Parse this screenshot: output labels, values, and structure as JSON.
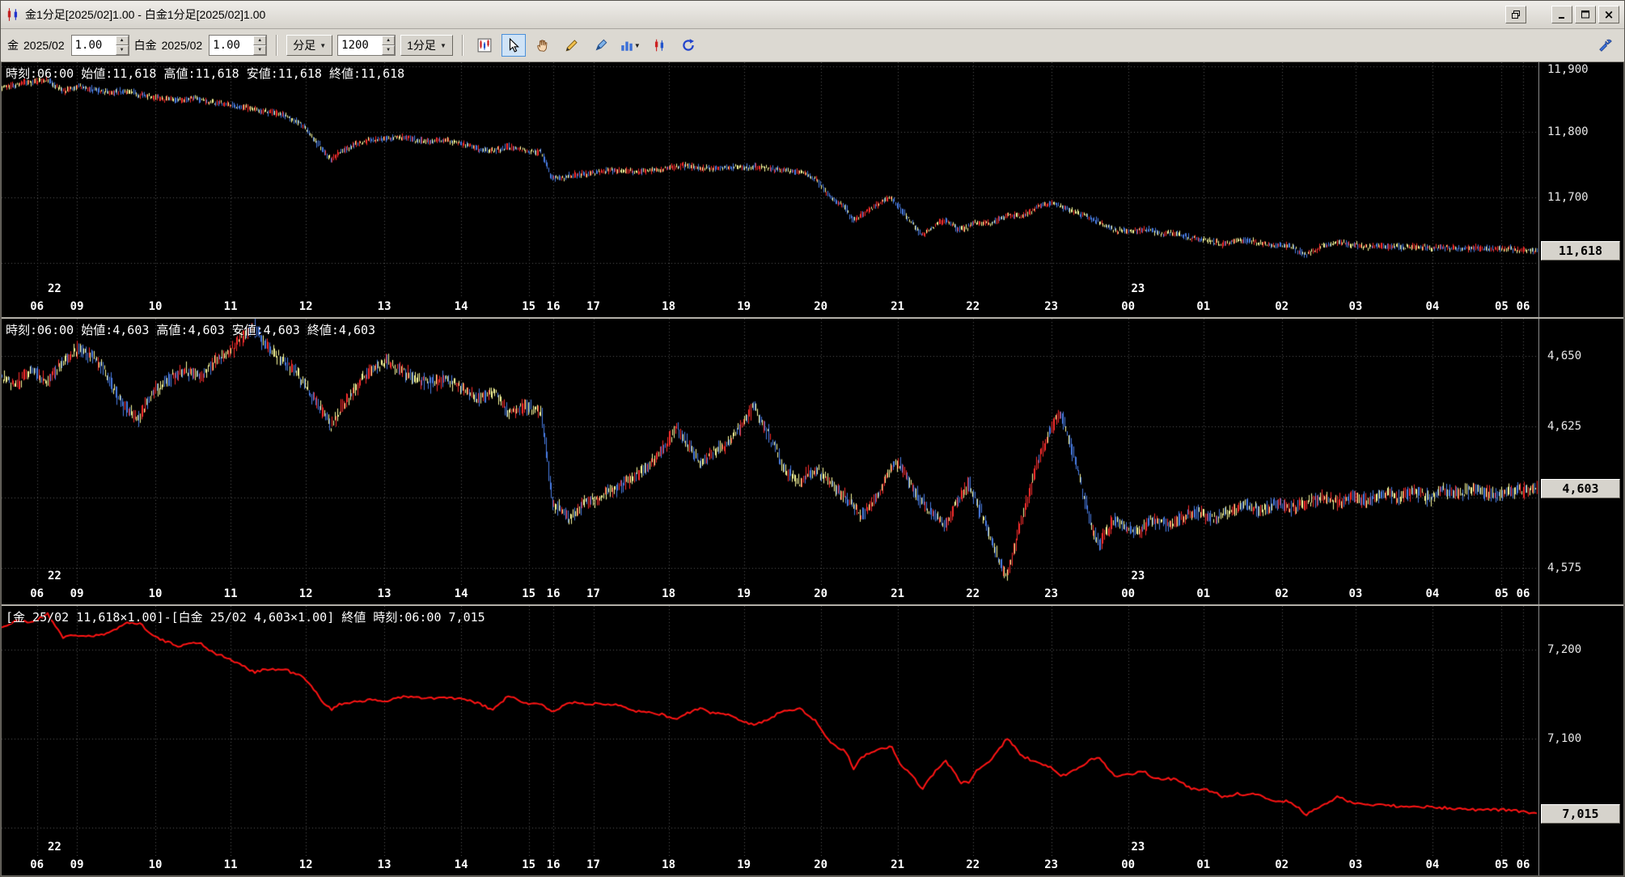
{
  "window": {
    "title": "金1分足[2025/02]1.00 - 白金1分足[2025/02]1.00",
    "close_glyph": "×"
  },
  "toolbar": {
    "gold_label": "金",
    "gold_contract": "2025/02",
    "gold_multiplier": "1.00",
    "platinum_label": "白金",
    "platinum_contract": "2025/02",
    "platinum_multiplier": "1.00",
    "period_type_label": "分足",
    "bar_count": "1200",
    "timeframe_label": "1分足",
    "icons": [
      "k-chart-icon",
      "cursor-icon",
      "hand-icon",
      "pencil-icon",
      "pen-icon",
      "histogram-icon",
      "candles-icon",
      "refresh-icon",
      "wrench-icon"
    ]
  },
  "colors": {
    "up": "#ff2e2e",
    "down": "#4b7fe8",
    "doji": "#ffff9e",
    "grid": "#565656",
    "plot_bg": "#000000",
    "axis_text": "#e8e8e8",
    "badge_bg": "#d6d3cc"
  },
  "time_axis": {
    "labels": [
      {
        "x": 0.023,
        "t": "06"
      },
      {
        "x": 0.049,
        "t": "09"
      },
      {
        "x": 0.1,
        "t": "10"
      },
      {
        "x": 0.149,
        "t": "11"
      },
      {
        "x": 0.198,
        "t": "12"
      },
      {
        "x": 0.249,
        "t": "13"
      },
      {
        "x": 0.299,
        "t": "14"
      },
      {
        "x": 0.343,
        "t": "15"
      },
      {
        "x": 0.359,
        "t": "16"
      },
      {
        "x": 0.385,
        "t": "17"
      },
      {
        "x": 0.434,
        "t": "18"
      },
      {
        "x": 0.483,
        "t": "19"
      },
      {
        "x": 0.533,
        "t": "20"
      },
      {
        "x": 0.583,
        "t": "21"
      },
      {
        "x": 0.632,
        "t": "22"
      },
      {
        "x": 0.683,
        "t": "23"
      },
      {
        "x": 0.733,
        "t": "00"
      },
      {
        "x": 0.782,
        "t": "01"
      },
      {
        "x": 0.833,
        "t": "02"
      },
      {
        "x": 0.881,
        "t": "03"
      },
      {
        "x": 0.931,
        "t": "04"
      },
      {
        "x": 0.976,
        "t": "05"
      },
      {
        "x": 0.99,
        "t": "06"
      }
    ]
  },
  "charts": [
    {
      "name": "gold",
      "type": "candlestick",
      "info_text": "時刻:06:00 始値:11,618 高値:11,618 安値:11,618 終値:11,618",
      "ylim": [
        11547,
        11906
      ],
      "yticks": [
        {
          "value": 11900,
          "label": "11,900"
        },
        {
          "value": 11800,
          "label": "11,800"
        },
        {
          "value": 11700,
          "label": "11,700"
        },
        {
          "value": 11600,
          "label": null
        }
      ],
      "badge_value": 11618,
      "badge_label": "11,618",
      "day_markers": [
        {
          "x": 0.03,
          "label": "22"
        },
        {
          "x": 0.735,
          "label": "23"
        }
      ],
      "bars": 1200,
      "noise": 6,
      "seed": 7,
      "anchors": [
        [
          0,
          11868
        ],
        [
          0.01,
          11872
        ],
        [
          0.02,
          11876
        ],
        [
          0.03,
          11880
        ],
        [
          0.04,
          11862
        ],
        [
          0.05,
          11868
        ],
        [
          0.06,
          11865
        ],
        [
          0.07,
          11860
        ],
        [
          0.08,
          11862
        ],
        [
          0.095,
          11855
        ],
        [
          0.105,
          11850
        ],
        [
          0.115,
          11848
        ],
        [
          0.125,
          11852
        ],
        [
          0.135,
          11845
        ],
        [
          0.15,
          11840
        ],
        [
          0.165,
          11835
        ],
        [
          0.175,
          11830
        ],
        [
          0.185,
          11825
        ],
        [
          0.195,
          11812
        ],
        [
          0.2,
          11800
        ],
        [
          0.205,
          11785
        ],
        [
          0.21,
          11770
        ],
        [
          0.215,
          11758
        ],
        [
          0.22,
          11768
        ],
        [
          0.23,
          11780
        ],
        [
          0.24,
          11788
        ],
        [
          0.25,
          11790
        ],
        [
          0.26,
          11792
        ],
        [
          0.27,
          11788
        ],
        [
          0.28,
          11785
        ],
        [
          0.29,
          11788
        ],
        [
          0.3,
          11782
        ],
        [
          0.31,
          11775
        ],
        [
          0.32,
          11770
        ],
        [
          0.33,
          11778
        ],
        [
          0.34,
          11772
        ],
        [
          0.352,
          11768
        ],
        [
          0.359,
          11728
        ],
        [
          0.37,
          11733
        ],
        [
          0.385,
          11738
        ],
        [
          0.4,
          11742
        ],
        [
          0.415,
          11738
        ],
        [
          0.43,
          11743
        ],
        [
          0.445,
          11748
        ],
        [
          0.46,
          11744
        ],
        [
          0.475,
          11746
        ],
        [
          0.49,
          11747
        ],
        [
          0.505,
          11743
        ],
        [
          0.52,
          11739
        ],
        [
          0.53,
          11730
        ],
        [
          0.54,
          11700
        ],
        [
          0.55,
          11685
        ],
        [
          0.555,
          11663
        ],
        [
          0.565,
          11680
        ],
        [
          0.575,
          11695
        ],
        [
          0.58,
          11700
        ],
        [
          0.59,
          11670
        ],
        [
          0.6,
          11642
        ],
        [
          0.61,
          11660
        ],
        [
          0.615,
          11665
        ],
        [
          0.625,
          11650
        ],
        [
          0.635,
          11662
        ],
        [
          0.645,
          11662
        ],
        [
          0.655,
          11672
        ],
        [
          0.665,
          11672
        ],
        [
          0.675,
          11685
        ],
        [
          0.685,
          11692
        ],
        [
          0.695,
          11682
        ],
        [
          0.705,
          11672
        ],
        [
          0.715,
          11662
        ],
        [
          0.725,
          11650
        ],
        [
          0.735,
          11648
        ],
        [
          0.745,
          11652
        ],
        [
          0.755,
          11645
        ],
        [
          0.765,
          11645
        ],
        [
          0.775,
          11638
        ],
        [
          0.785,
          11636
        ],
        [
          0.795,
          11628
        ],
        [
          0.805,
          11634
        ],
        [
          0.815,
          11633
        ],
        [
          0.825,
          11629
        ],
        [
          0.84,
          11625
        ],
        [
          0.85,
          11612
        ],
        [
          0.86,
          11625
        ],
        [
          0.87,
          11632
        ],
        [
          0.88,
          11628
        ],
        [
          0.89,
          11625
        ],
        [
          0.9,
          11626
        ],
        [
          0.91,
          11624
        ],
        [
          0.92,
          11625
        ],
        [
          0.93,
          11623
        ],
        [
          0.94,
          11624
        ],
        [
          0.95,
          11622
        ],
        [
          0.96,
          11623
        ],
        [
          0.97,
          11621
        ],
        [
          0.98,
          11622
        ],
        [
          0.99,
          11620
        ],
        [
          1,
          11618
        ]
      ]
    },
    {
      "name": "platinum",
      "type": "candlestick",
      "info_text": "時刻:06:00 始値:4,603 高値:4,603 安値:4,603 終値:4,603",
      "ylim": [
        4569,
        4663
      ],
      "yticks": [
        {
          "value": 4650,
          "label": "4,650"
        },
        {
          "value": 4625,
          "label": "4,625"
        },
        {
          "value": 4600,
          "label": null
        },
        {
          "value": 4575,
          "label": "4,575"
        }
      ],
      "badge_value": 4603,
      "badge_label": "4,603",
      "day_markers": [
        {
          "x": 0.03,
          "label": "22"
        },
        {
          "x": 0.735,
          "label": "23"
        }
      ],
      "bars": 1200,
      "noise": 3,
      "seed": 13,
      "anchors": [
        [
          0,
          4643
        ],
        [
          0.01,
          4640
        ],
        [
          0.02,
          4645
        ],
        [
          0.03,
          4640
        ],
        [
          0.04,
          4648
        ],
        [
          0.05,
          4652
        ],
        [
          0.06,
          4650
        ],
        [
          0.07,
          4642
        ],
        [
          0.08,
          4632
        ],
        [
          0.09,
          4628
        ],
        [
          0.1,
          4638
        ],
        [
          0.11,
          4642
        ],
        [
          0.12,
          4645
        ],
        [
          0.13,
          4642
        ],
        [
          0.14,
          4648
        ],
        [
          0.15,
          4652
        ],
        [
          0.16,
          4658
        ],
        [
          0.165,
          4660
        ],
        [
          0.17,
          4655
        ],
        [
          0.18,
          4650
        ],
        [
          0.19,
          4645
        ],
        [
          0.2,
          4638
        ],
        [
          0.21,
          4630
        ],
        [
          0.215,
          4625
        ],
        [
          0.22,
          4630
        ],
        [
          0.23,
          4638
        ],
        [
          0.24,
          4645
        ],
        [
          0.25,
          4648
        ],
        [
          0.26,
          4645
        ],
        [
          0.27,
          4642
        ],
        [
          0.28,
          4640
        ],
        [
          0.29,
          4642
        ],
        [
          0.3,
          4638
        ],
        [
          0.31,
          4635
        ],
        [
          0.32,
          4638
        ],
        [
          0.33,
          4630
        ],
        [
          0.34,
          4632
        ],
        [
          0.352,
          4630
        ],
        [
          0.359,
          4598
        ],
        [
          0.365,
          4595
        ],
        [
          0.37,
          4592
        ],
        [
          0.38,
          4598
        ],
        [
          0.39,
          4600
        ],
        [
          0.4,
          4603
        ],
        [
          0.41,
          4606
        ],
        [
          0.42,
          4610
        ],
        [
          0.43,
          4616
        ],
        [
          0.44,
          4625
        ],
        [
          0.45,
          4616
        ],
        [
          0.455,
          4612
        ],
        [
          0.465,
          4616
        ],
        [
          0.475,
          4620
        ],
        [
          0.485,
          4628
        ],
        [
          0.49,
          4632
        ],
        [
          0.5,
          4622
        ],
        [
          0.51,
          4610
        ],
        [
          0.52,
          4605
        ],
        [
          0.53,
          4610
        ],
        [
          0.54,
          4605
        ],
        [
          0.55,
          4600
        ],
        [
          0.56,
          4593
        ],
        [
          0.57,
          4600
        ],
        [
          0.58,
          4610
        ],
        [
          0.585,
          4612
        ],
        [
          0.595,
          4602
        ],
        [
          0.605,
          4595
        ],
        [
          0.615,
          4590
        ],
        [
          0.625,
          4600
        ],
        [
          0.63,
          4605
        ],
        [
          0.64,
          4592
        ],
        [
          0.65,
          4578
        ],
        [
          0.655,
          4572
        ],
        [
          0.665,
          4592
        ],
        [
          0.675,
          4612
        ],
        [
          0.685,
          4626
        ],
        [
          0.69,
          4630
        ],
        [
          0.7,
          4612
        ],
        [
          0.71,
          4590
        ],
        [
          0.715,
          4583
        ],
        [
          0.725,
          4592
        ],
        [
          0.73,
          4590
        ],
        [
          0.74,
          4588
        ],
        [
          0.75,
          4592
        ],
        [
          0.76,
          4590
        ],
        [
          0.77,
          4593
        ],
        [
          0.78,
          4595
        ],
        [
          0.79,
          4592
        ],
        [
          0.8,
          4595
        ],
        [
          0.81,
          4597
        ],
        [
          0.82,
          4595
        ],
        [
          0.83,
          4598
        ],
        [
          0.84,
          4596
        ],
        [
          0.85,
          4598
        ],
        [
          0.86,
          4600
        ],
        [
          0.87,
          4598
        ],
        [
          0.88,
          4600
        ],
        [
          0.89,
          4599
        ],
        [
          0.9,
          4601
        ],
        [
          0.91,
          4600
        ],
        [
          0.92,
          4602
        ],
        [
          0.93,
          4600
        ],
        [
          0.94,
          4602
        ],
        [
          0.95,
          4601
        ],
        [
          0.96,
          4603
        ],
        [
          0.97,
          4601
        ],
        [
          0.98,
          4602
        ],
        [
          0.99,
          4602
        ],
        [
          1,
          4603
        ]
      ]
    },
    {
      "name": "spread",
      "type": "line",
      "formula": "subtract",
      "source_a": 0,
      "source_b": 1,
      "line_color": "#ff1414",
      "info_text": "[金 25/02 11,618×1.00]-[白金 25/02 4,603×1.00] 終値 時刻:06:00 7,015",
      "ylim": [
        6968,
        7249
      ],
      "yticks": [
        {
          "value": 7200,
          "label": "7,200"
        },
        {
          "value": 7100,
          "label": "7,100"
        },
        {
          "value": 7000,
          "label": null
        }
      ],
      "badge_value": 7015,
      "badge_label": "7,015",
      "day_markers": [
        {
          "x": 0.03,
          "label": "22"
        },
        {
          "x": 0.735,
          "label": "23"
        }
      ],
      "noise": 3,
      "seed": 21
    }
  ]
}
